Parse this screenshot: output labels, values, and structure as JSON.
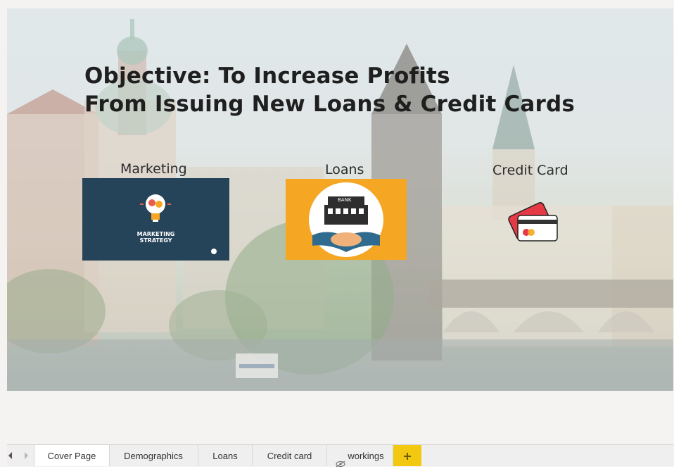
{
  "title": {
    "line1": "Objective: To Increase Profits",
    "line2": "From Issuing New Loans & Credit Cards"
  },
  "sections": {
    "marketing": {
      "label": "Marketing",
      "image_text_line1": "MARKETING",
      "image_text_line2": "STRATEGY"
    },
    "loans": {
      "label": "Loans",
      "image_text": "BANK"
    },
    "credit": {
      "label": "Credit Card"
    }
  },
  "tabs": [
    {
      "label": "Cover Page",
      "active": true
    },
    {
      "label": "Demographics",
      "active": false
    },
    {
      "label": "Loans",
      "active": false
    },
    {
      "label": "Credit card",
      "active": false
    },
    {
      "label": "workings",
      "active": false,
      "icon": "hidden-eye-icon"
    }
  ],
  "colors": {
    "marketing_bg": "#264459",
    "loans_bg": "#f5a623",
    "add_tab": "#f2c811",
    "credit_card": "#e63946"
  },
  "icons": [
    "lightbulb-icon",
    "bank-handshake-icon",
    "credit-card-icon",
    "hidden-eye-icon",
    "plus-icon",
    "chevron-left-icon",
    "chevron-right-icon"
  ]
}
